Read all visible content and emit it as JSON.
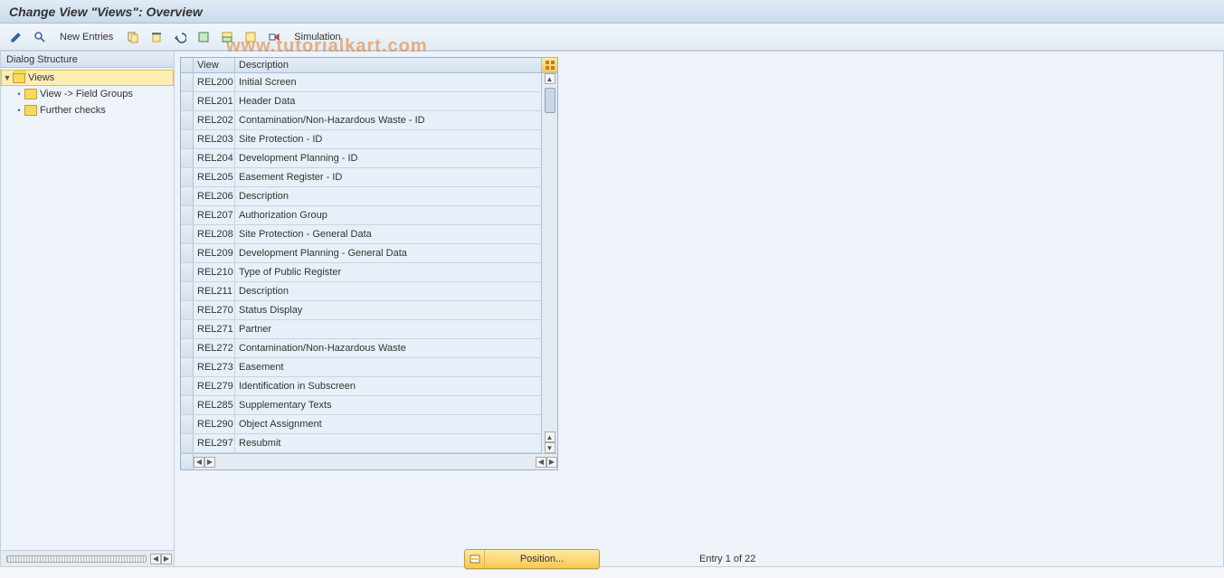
{
  "title": "Change View \"Views\": Overview",
  "toolbar": {
    "new_entries": "New Entries",
    "simulation": "Simulation"
  },
  "dialog_structure": {
    "header": "Dialog Structure",
    "nodes": [
      {
        "label": "Views",
        "selected": true,
        "level": 0,
        "expanded": true
      },
      {
        "label": "View -> Field Groups",
        "selected": false,
        "level": 1,
        "expanded": false
      },
      {
        "label": "Further checks",
        "selected": false,
        "level": 1,
        "expanded": false
      }
    ]
  },
  "grid": {
    "columns": {
      "view": "View",
      "description": "Description"
    },
    "rows": [
      {
        "view": "REL200",
        "desc": "Initial Screen"
      },
      {
        "view": "REL201",
        "desc": "Header Data"
      },
      {
        "view": "REL202",
        "desc": "Contamination/Non-Hazardous Waste - ID"
      },
      {
        "view": "REL203",
        "desc": "Site Protection - ID"
      },
      {
        "view": "REL204",
        "desc": "Development Planning - ID"
      },
      {
        "view": "REL205",
        "desc": "Easement Register - ID"
      },
      {
        "view": "REL206",
        "desc": "Description"
      },
      {
        "view": "REL207",
        "desc": "Authorization Group"
      },
      {
        "view": "REL208",
        "desc": "Site Protection - General Data"
      },
      {
        "view": "REL209",
        "desc": "Development Planning - General Data"
      },
      {
        "view": "REL210",
        "desc": "Type of Public Register"
      },
      {
        "view": "REL211",
        "desc": "Description"
      },
      {
        "view": "REL270",
        "desc": "Status Display"
      },
      {
        "view": "REL271",
        "desc": "Partner"
      },
      {
        "view": "REL272",
        "desc": "Contamination/Non-Hazardous Waste"
      },
      {
        "view": "REL273",
        "desc": "Easement"
      },
      {
        "view": "REL279",
        "desc": "Identification in Subscreen"
      },
      {
        "view": "REL285",
        "desc": "Supplementary Texts"
      },
      {
        "view": "REL290",
        "desc": "Object Assignment"
      },
      {
        "view": "REL297",
        "desc": "Resubmit"
      }
    ]
  },
  "footer": {
    "position_label": "Position...",
    "entry_text": "Entry 1 of 22"
  },
  "watermark": "www.tutorialkart.com"
}
